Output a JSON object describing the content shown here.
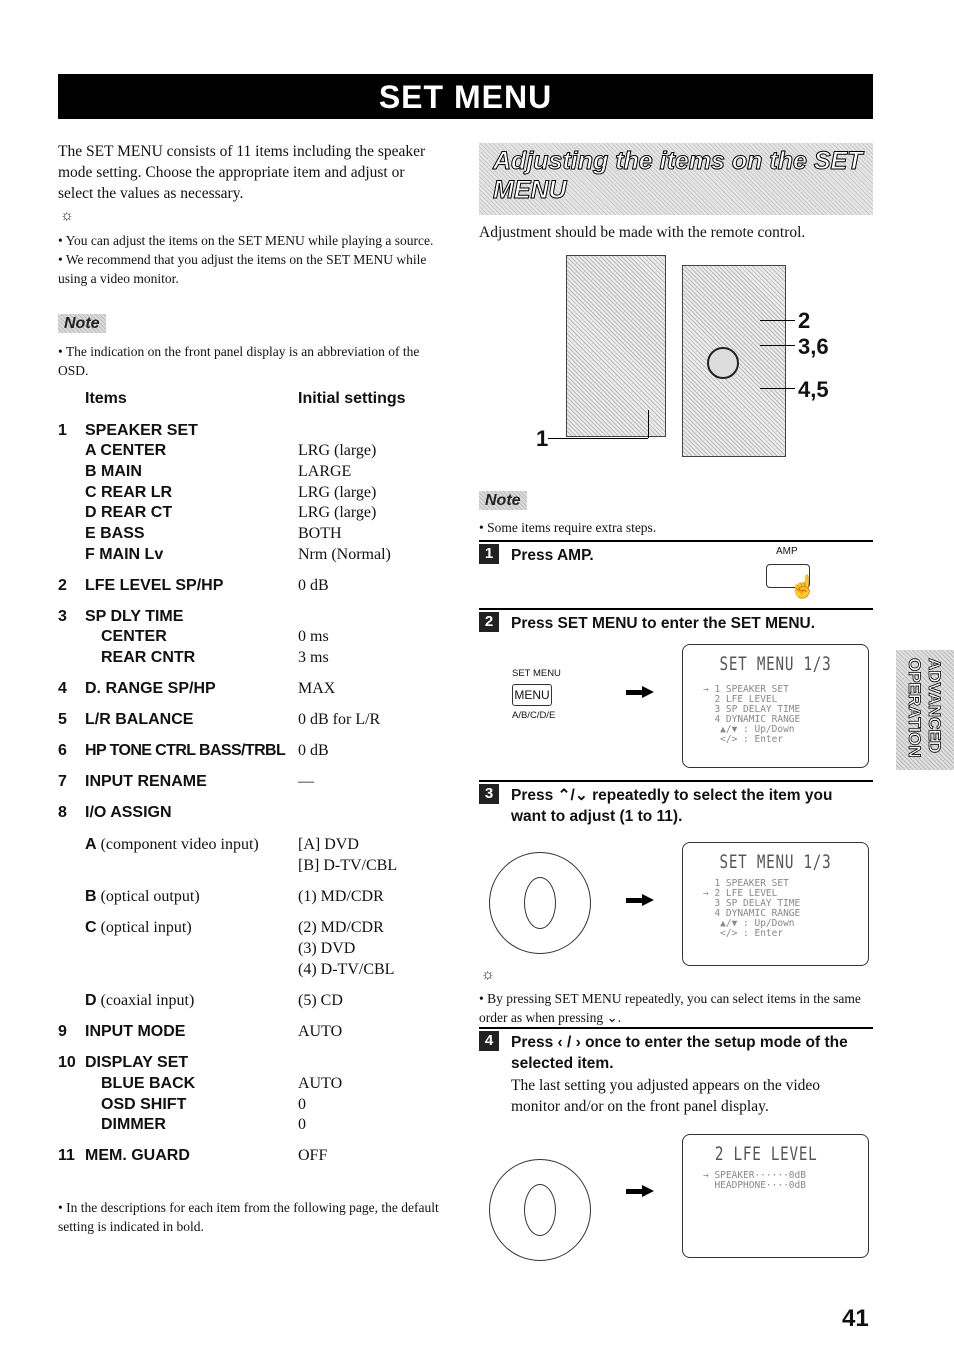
{
  "banner": "SET MENU",
  "intro": "The SET MENU consists of 11 items including the speaker mode setting. Choose the appropriate item and adjust or select the values as necessary.",
  "tips": [
    "You can adjust the items on the SET MENU while playing a source.",
    "We recommend that you adjust the items on the SET MENU while using a video monitor."
  ],
  "note_label": "Note",
  "note1": "The indication on the front panel display is an abbreviation of the OSD.",
  "table": {
    "col_items": "Items",
    "col_initial": "Initial settings",
    "rows": [
      {
        "n": "1",
        "l": "SPEAKER SET",
        "v": ""
      },
      {
        "n": "",
        "l": "A CENTER",
        "v": "LRG (large)",
        "i": 1
      },
      {
        "n": "",
        "l": "B MAIN",
        "v": "LARGE",
        "i": 1
      },
      {
        "n": "",
        "l": "C REAR LR",
        "v": "LRG (large)",
        "i": 1
      },
      {
        "n": "",
        "l": "D REAR CT",
        "v": "LRG (large)",
        "i": 1
      },
      {
        "n": "",
        "l": "E BASS",
        "v": "BOTH",
        "i": 1
      },
      {
        "n": "",
        "l": "F MAIN Lv",
        "v": "Nrm (Normal)",
        "i": 1
      },
      {
        "n": "2",
        "l": "LFE LEVEL SP/HP",
        "v": "0 dB"
      },
      {
        "n": "3",
        "l": "SP DLY TIME",
        "v": ""
      },
      {
        "n": "",
        "l": "CENTER",
        "v": "0 ms",
        "i": 2
      },
      {
        "n": "",
        "l": "REAR CNTR",
        "v": "3 ms",
        "i": 2
      },
      {
        "n": "4",
        "l": "D. RANGE SP/HP",
        "v": "MAX"
      },
      {
        "n": "5",
        "l": "L/R BALANCE",
        "v": "0 dB for L/R"
      },
      {
        "n": "6",
        "l": "HP TONE CTRL BASS/TRBL",
        "v": "0 dB"
      },
      {
        "n": "7",
        "l": "INPUT RENAME",
        "v": "—"
      },
      {
        "n": "8",
        "l": "I/O ASSIGN",
        "v": ""
      },
      {
        "n": "",
        "l": "A",
        "s": " (component video input)",
        "v": "[A] DVD",
        "i": 1
      },
      {
        "n": "",
        "l": "",
        "v": "[B] D-TV/CBL",
        "i": 1
      },
      {
        "n": "",
        "l": "B",
        "s": " (optical output)",
        "v": "(1) MD/CDR",
        "i": 1
      },
      {
        "n": "",
        "l": "C",
        "s": " (optical input)",
        "v": "(2) MD/CDR",
        "i": 1
      },
      {
        "n": "",
        "l": "",
        "v": "(3) DVD",
        "i": 1
      },
      {
        "n": "",
        "l": "",
        "v": "(4) D-TV/CBL",
        "i": 1
      },
      {
        "n": "",
        "l": "D",
        "s": " (coaxial input)",
        "v": "(5) CD",
        "i": 1
      },
      {
        "n": "9",
        "l": "INPUT MODE",
        "v": "AUTO"
      },
      {
        "n": "10",
        "l": "DISPLAY SET",
        "v": ""
      },
      {
        "n": "",
        "l": "BLUE BACK",
        "v": "AUTO",
        "i": 2
      },
      {
        "n": "",
        "l": "OSD SHIFT",
        "v": "0",
        "i": 2
      },
      {
        "n": "",
        "l": "DIMMER",
        "v": "0",
        "i": 2
      },
      {
        "n": "11",
        "l": "MEM. GUARD",
        "v": "OFF"
      }
    ]
  },
  "footnote": "In the descriptions for each item from the following page, the default setting is indicated in bold.",
  "right": {
    "heading": "Adjusting the items on the SET MENU",
    "sub": "Adjustment should be made with the remote control.",
    "callouts": [
      "1",
      "2",
      "3,6",
      "4,5"
    ],
    "note": "Some items require extra steps.",
    "steps": [
      {
        "num": "1",
        "title": "Press AMP.",
        "button": "AMP"
      },
      {
        "num": "2",
        "title": "Press SET MENU to enter the SET MENU.",
        "top_label": "SET MENU",
        "button": "MENU",
        "bottom_label": "A/B/C/D/E"
      },
      {
        "num": "3",
        "title": "Press ⌃/⌄ repeatedly to select the item you want to adjust (1 to 11)."
      },
      {
        "num": "4",
        "title": "Press ‹ / › once to enter the setup mode of the selected item.",
        "body": "The last setting you adjusted appears on the video monitor and/or on the front panel display."
      }
    ],
    "osd1": {
      "title": "SET MENU 1/3",
      "lines": "→ 1 SPEAKER SET\n  2 LFE LEVEL\n  3 SP DELAY TIME\n  4 DYNAMIC RANGE\n   ▲/▼ : Up/Down\n   </> : Enter"
    },
    "osd2": {
      "title": "SET MENU 1/3",
      "lines": "  1 SPEAKER SET\n→ 2 LFE LEVEL\n  3 SP DELAY TIME\n  4 DYNAMIC RANGE\n   ▲/▼ : Up/Down\n   </> : Enter"
    },
    "osd3": {
      "title": "2 LFE LEVEL",
      "lines": "→ SPEAKER······0dB\n  HEADPHONE····0dB"
    },
    "tip": "By pressing SET MENU repeatedly, you can select items in the same order as when pressing ⌄."
  },
  "side_tab": "ADVANCED OPERATION",
  "page_number": "41"
}
